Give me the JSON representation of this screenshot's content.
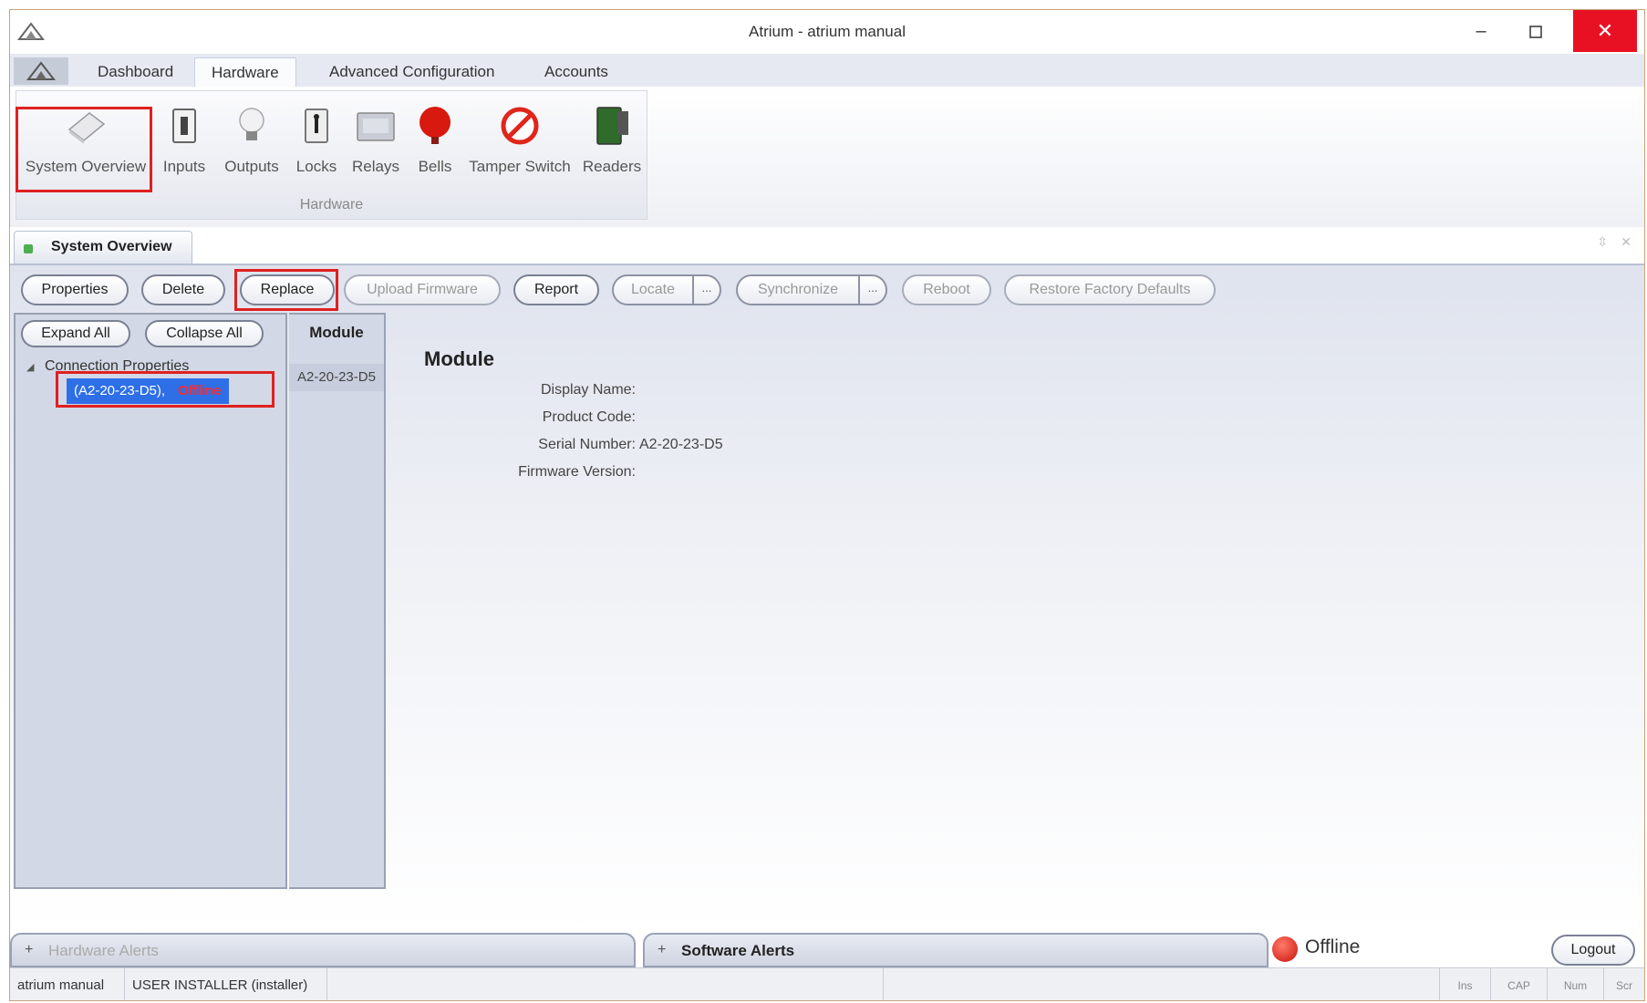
{
  "window": {
    "title": "Atrium - atrium manual"
  },
  "ribbon": {
    "tabs": [
      {
        "label": "Dashboard"
      },
      {
        "label": "Hardware"
      },
      {
        "label": "Advanced Configuration"
      },
      {
        "label": "Accounts"
      }
    ],
    "active_tab": "Hardware",
    "group_label": "Hardware",
    "buttons": [
      {
        "label": "System Overview",
        "icon": "system-overview-icon"
      },
      {
        "label": "Inputs",
        "icon": "switch-icon"
      },
      {
        "label": "Outputs",
        "icon": "light-bulb-icon"
      },
      {
        "label": "Locks",
        "icon": "lock-icon"
      },
      {
        "label": "Relays",
        "icon": "relay-icon"
      },
      {
        "label": "Bells",
        "icon": "bell-icon"
      },
      {
        "label": "Tamper Switch",
        "icon": "no-symbol-icon"
      },
      {
        "label": "Readers",
        "icon": "card-reader-icon"
      }
    ]
  },
  "doc_tab": {
    "label": "System Overview"
  },
  "toolbar": {
    "properties": "Properties",
    "delete": "Delete",
    "replace": "Replace",
    "upload_firmware": "Upload Firmware",
    "report": "Report",
    "locate": "Locate",
    "synchronize": "Synchronize",
    "dropdown_glyph": "...",
    "reboot": "Reboot",
    "restore": "Restore Factory Defaults"
  },
  "tree": {
    "expand_all": "Expand All",
    "collapse_all": "Collapse All",
    "root": "Connection Properties",
    "item_id": "(A2-20-23-D5),",
    "item_status": "Offline"
  },
  "module_list": {
    "header": "Module",
    "rows": [
      "A2-20-23-D5"
    ]
  },
  "details": {
    "title": "Module",
    "fields": [
      {
        "label": "Display Name:",
        "value": ""
      },
      {
        "label": "Product Code:",
        "value": ""
      },
      {
        "label": "Serial Number:",
        "value": "A2-20-23-D5"
      },
      {
        "label": "Firmware Version:",
        "value": ""
      }
    ]
  },
  "alerts": {
    "hardware": "Hardware Alerts",
    "software": "Software Alerts",
    "plus_glyph": "+"
  },
  "connection": {
    "status": "Offline",
    "logout": "Logout"
  },
  "statusbar": {
    "site": "atrium manual",
    "user": "USER INSTALLER (installer)",
    "indicators": [
      "Ins",
      "CAP",
      "Num",
      "Scr"
    ]
  },
  "colors": {
    "highlight_red": "#e02020",
    "selection_blue": "#2e6fe8",
    "close_red": "#e81123"
  }
}
